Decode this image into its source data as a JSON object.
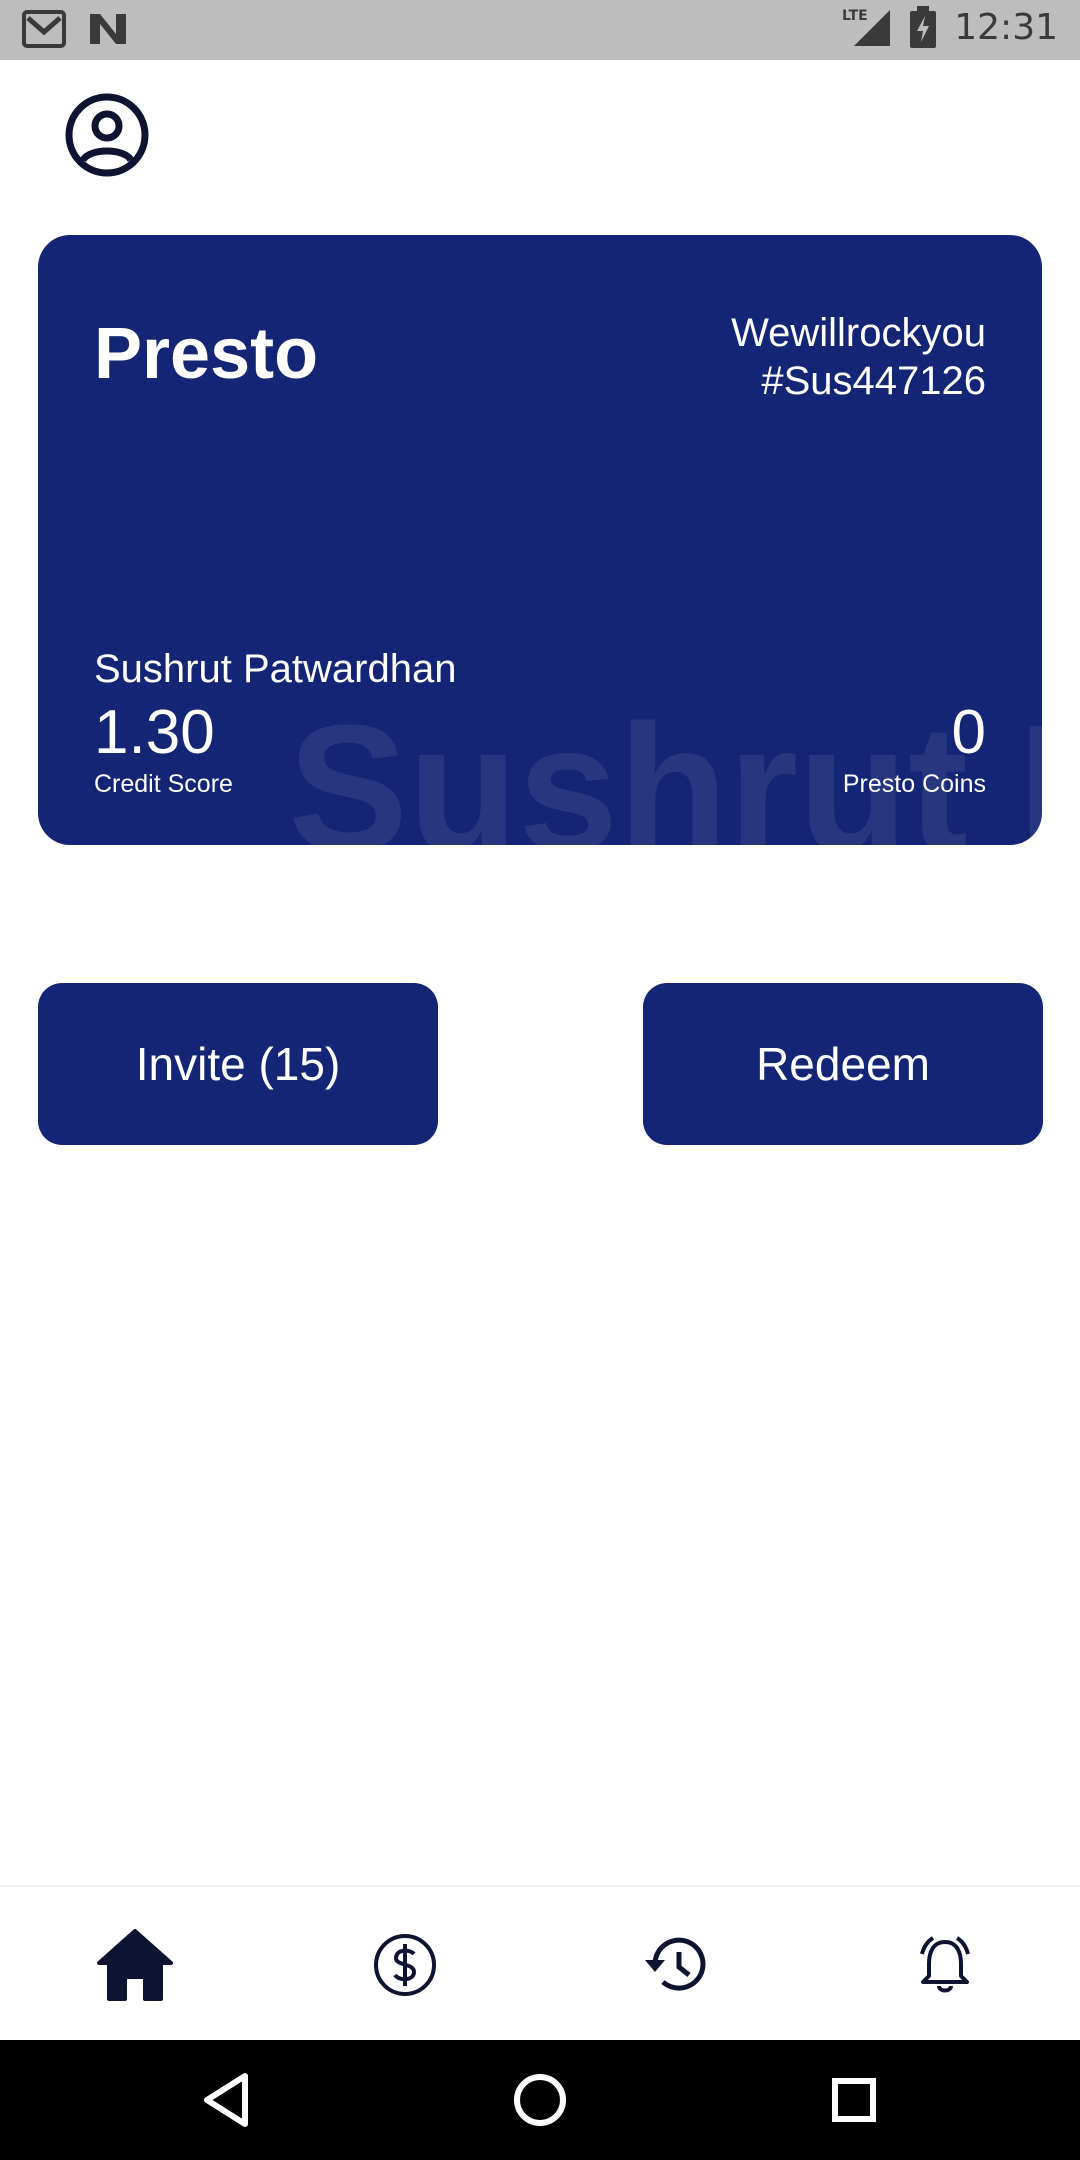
{
  "status_bar": {
    "time": "12:31",
    "network": "LTE",
    "icons": [
      "gmail-icon",
      "n-icon",
      "signal-icon",
      "battery-icon"
    ]
  },
  "header": {
    "profile_icon": "account-circle-icon"
  },
  "card": {
    "brand": "Presto",
    "username_line1": "Wewillrockyou",
    "username_line2": "#Sus447126",
    "holder_name": "Sushrut Patwardhan",
    "watermark": "Sushrut P",
    "credit_score": "1.30",
    "credit_score_label": "Credit Score",
    "coins": "0",
    "coins_label": "Presto Coins",
    "color": "#152575"
  },
  "actions": {
    "invite_label": "Invite (15)",
    "redeem_label": "Redeem"
  },
  "bottom_nav": {
    "items": [
      {
        "icon": "home-icon",
        "active": true
      },
      {
        "icon": "dollar-circle-icon",
        "active": false
      },
      {
        "icon": "history-icon",
        "active": false
      },
      {
        "icon": "alarm-bell-icon",
        "active": false
      }
    ]
  },
  "system_nav": {
    "icons": [
      "back-icon",
      "home-circle-icon",
      "recents-icon"
    ]
  }
}
